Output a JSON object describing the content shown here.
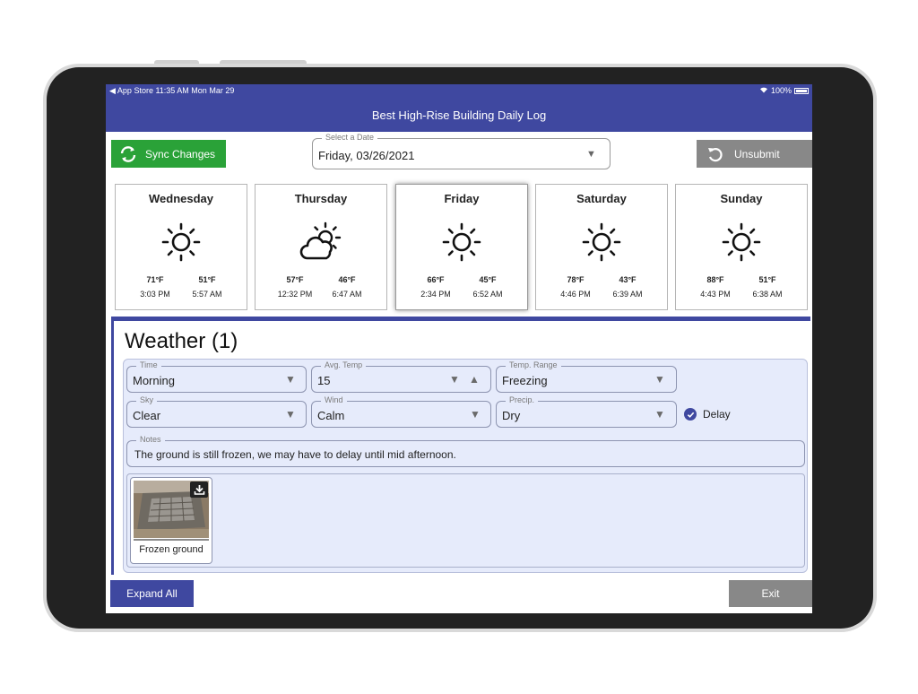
{
  "status_bar": {
    "left": "◀ App Store  11:35 AM  Mon Mar 29",
    "battery": "100%"
  },
  "app": {
    "title": "Best High-Rise Building Daily Log"
  },
  "toolbar": {
    "sync_label": "Sync Changes",
    "date_label": "Select a Date",
    "date_value": "Friday, 03/26/2021",
    "unsubmit_label": "Unsubmit"
  },
  "forecast": [
    {
      "day": "Wednesday",
      "icon": "sun-icon",
      "high": "71°F",
      "low": "51°F",
      "high_time": "3:03 PM",
      "low_time": "5:57 AM",
      "selected": false
    },
    {
      "day": "Thursday",
      "icon": "partly-cloudy-icon",
      "high": "57°F",
      "low": "46°F",
      "high_time": "12:32 PM",
      "low_time": "6:47 AM",
      "selected": false
    },
    {
      "day": "Friday",
      "icon": "sun-icon",
      "high": "66°F",
      "low": "45°F",
      "high_time": "2:34 PM",
      "low_time": "6:52 AM",
      "selected": true
    },
    {
      "day": "Saturday",
      "icon": "sun-icon",
      "high": "78°F",
      "low": "43°F",
      "high_time": "4:46 PM",
      "low_time": "6:39 AM",
      "selected": false
    },
    {
      "day": "Sunday",
      "icon": "sun-icon",
      "high": "88°F",
      "low": "51°F",
      "high_time": "4:43 PM",
      "low_time": "6:38 AM",
      "selected": false
    }
  ],
  "weather": {
    "title": "Weather (1)",
    "time": {
      "label": "Time",
      "value": "Morning"
    },
    "avg_temp": {
      "label": "Avg. Temp",
      "value": "15"
    },
    "temp_range": {
      "label": "Temp. Range",
      "value": "Freezing"
    },
    "sky": {
      "label": "Sky",
      "value": "Clear"
    },
    "wind": {
      "label": "Wind",
      "value": "Calm"
    },
    "precip": {
      "label": "Precip.",
      "value": "Dry"
    },
    "delay": {
      "label": "Delay",
      "checked": true
    },
    "notes": {
      "label": "Notes",
      "value": "The ground is still frozen, we may have to delay until mid afternoon."
    },
    "photo": {
      "caption": "Frozen ground"
    }
  },
  "footer": {
    "expand_label": "Expand All",
    "exit_label": "Exit"
  },
  "colors": {
    "brand": "#3f48a0",
    "sync": "#2aa238",
    "disabled": "#888888",
    "panel": "#e6ebfb"
  }
}
